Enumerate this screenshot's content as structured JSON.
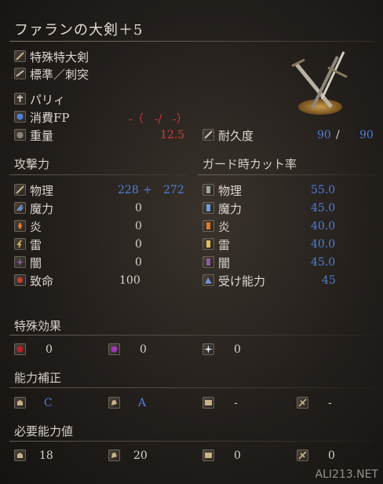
{
  "weapon": {
    "name": "ファランの大剣＋5",
    "category": "特殊特大剣",
    "attack_type": "標準／刺突",
    "skill": "パリィ",
    "fp_label": "消費FP",
    "fp_value": "-（　-/　-）",
    "weight_label": "重量",
    "weight_value": "12.5",
    "durability_label": "耐久度",
    "durability_current": "90",
    "durability_sep": "/",
    "durability_max": "90"
  },
  "attack": {
    "header": "攻撃力",
    "rows": [
      {
        "label": "物理",
        "value": "228",
        "bonus_sign": "+",
        "bonus": "272"
      },
      {
        "label": "魔力",
        "value": "0"
      },
      {
        "label": "炎",
        "value": "0"
      },
      {
        "label": "雷",
        "value": "0"
      },
      {
        "label": "闇",
        "value": "0"
      },
      {
        "label": "致命",
        "value": "100"
      }
    ]
  },
  "guard": {
    "header": "ガード時カット率",
    "rows": [
      {
        "label": "物理",
        "value": "55.0"
      },
      {
        "label": "魔力",
        "value": "45.0"
      },
      {
        "label": "炎",
        "value": "40.0"
      },
      {
        "label": "雷",
        "value": "40.0"
      },
      {
        "label": "闇",
        "value": "45.0"
      },
      {
        "label": "受け能力",
        "value": "45"
      }
    ]
  },
  "special": {
    "header": "特殊効果",
    "items": [
      {
        "icon": "bleed-icon",
        "value": "0"
      },
      {
        "icon": "poison-icon",
        "value": "0"
      },
      {
        "icon": "frost-icon",
        "value": "0"
      }
    ]
  },
  "scaling": {
    "header": "能力補正",
    "items": [
      {
        "icon": "strength-icon",
        "value": "C"
      },
      {
        "icon": "dexterity-icon",
        "value": "A"
      },
      {
        "icon": "intelligence-icon",
        "value": "-"
      },
      {
        "icon": "faith-icon",
        "value": "-"
      }
    ]
  },
  "requirements": {
    "header": "必要能力値",
    "items": [
      {
        "icon": "strength-icon",
        "value": "18"
      },
      {
        "icon": "dexterity-icon",
        "value": "20"
      },
      {
        "icon": "intelligence-icon",
        "value": "0"
      },
      {
        "icon": "faith-icon",
        "value": "0"
      }
    ]
  },
  "watermark": "ALI213.NET",
  "colors": {
    "blue": "#4f7fd8",
    "red": "#d63a35",
    "text": "#d8d4cc"
  }
}
